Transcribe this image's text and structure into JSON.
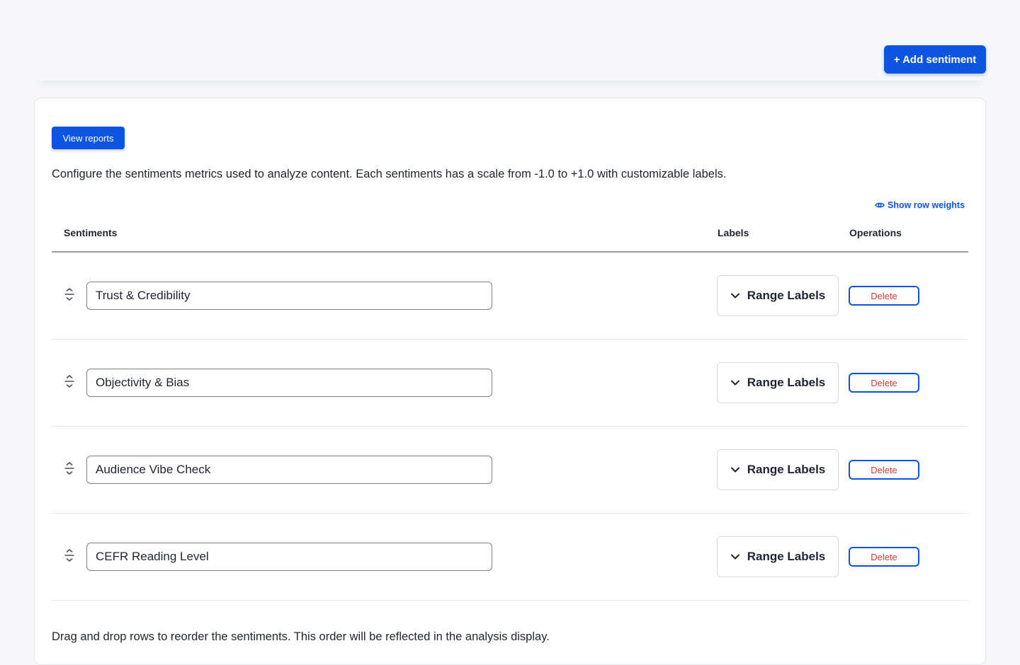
{
  "header": {
    "add_button_label": "+ Add sentiment"
  },
  "card": {
    "view_reports_label": "View reports",
    "description": "Configure the sentiments metrics used to analyze content. Each sentiments has a scale from -1.0 to +1.0 with customizable labels.",
    "show_weights_label": "Show row weights",
    "footer_note": "Drag and drop rows to reorder the sentiments. This order will be reflected in the analysis display."
  },
  "table": {
    "columns": {
      "sentiments": "Sentiments",
      "labels": "Labels",
      "operations": "Operations"
    },
    "rows": [
      {
        "name": "Trust & Credibility",
        "labels_button": "Range Labels",
        "delete_label": "Delete"
      },
      {
        "name": "Objectivity & Bias",
        "labels_button": "Range Labels",
        "delete_label": "Delete"
      },
      {
        "name": "Audience Vibe Check",
        "labels_button": "Range Labels",
        "delete_label": "Delete"
      },
      {
        "name": "CEFR Reading Level",
        "labels_button": "Range Labels",
        "delete_label": "Delete"
      }
    ]
  },
  "icons": {
    "drag_handle": "drag-handle-icon",
    "chevron": "chevron-down-icon",
    "eye": "eye-icon"
  },
  "colors": {
    "accent": "#0b55e0",
    "danger": "#d23a3a",
    "background": "#f5f7fb"
  }
}
